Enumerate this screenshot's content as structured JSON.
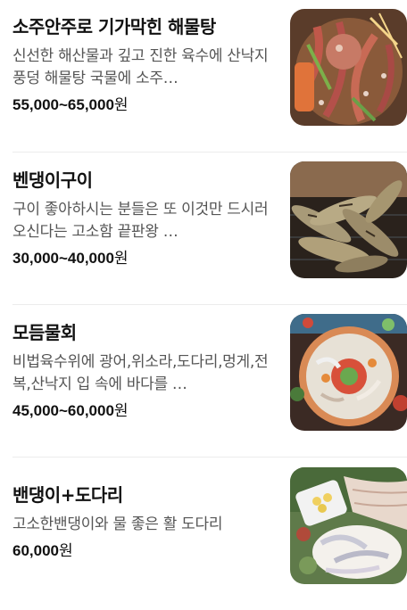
{
  "menu": {
    "items": [
      {
        "name": "소주안주로 기가막힌 해물탕",
        "description": "신선한 해산물과 깊고 진한 육수에 산낙지 풍덩 해물탕 국물에 소주…",
        "price_range": "55,000~65,000",
        "price_unit": "원",
        "image_icon": "seafood-stew-photo"
      },
      {
        "name": "벤댕이구이",
        "description": "구이 좋아하시는 분들은 또 이것만 드시러 오신다는 고소함 끝판왕 …",
        "price_range": "30,000~40,000",
        "price_unit": "원",
        "image_icon": "grilled-fish-photo"
      },
      {
        "name": "모듬물회",
        "description": "비법육수위에 광어,위소라,도다리,멍게,전복,산낙지 입 속에 바다를 …",
        "price_range": "45,000~60,000",
        "price_unit": "원",
        "image_icon": "cold-raw-fish-soup-photo"
      },
      {
        "name": "밴댕이+도다리",
        "description": "고소한밴댕이와 물 좋은 활 도다리",
        "price_range": "60,000",
        "price_unit": "원",
        "image_icon": "sashimi-platter-photo"
      }
    ]
  }
}
